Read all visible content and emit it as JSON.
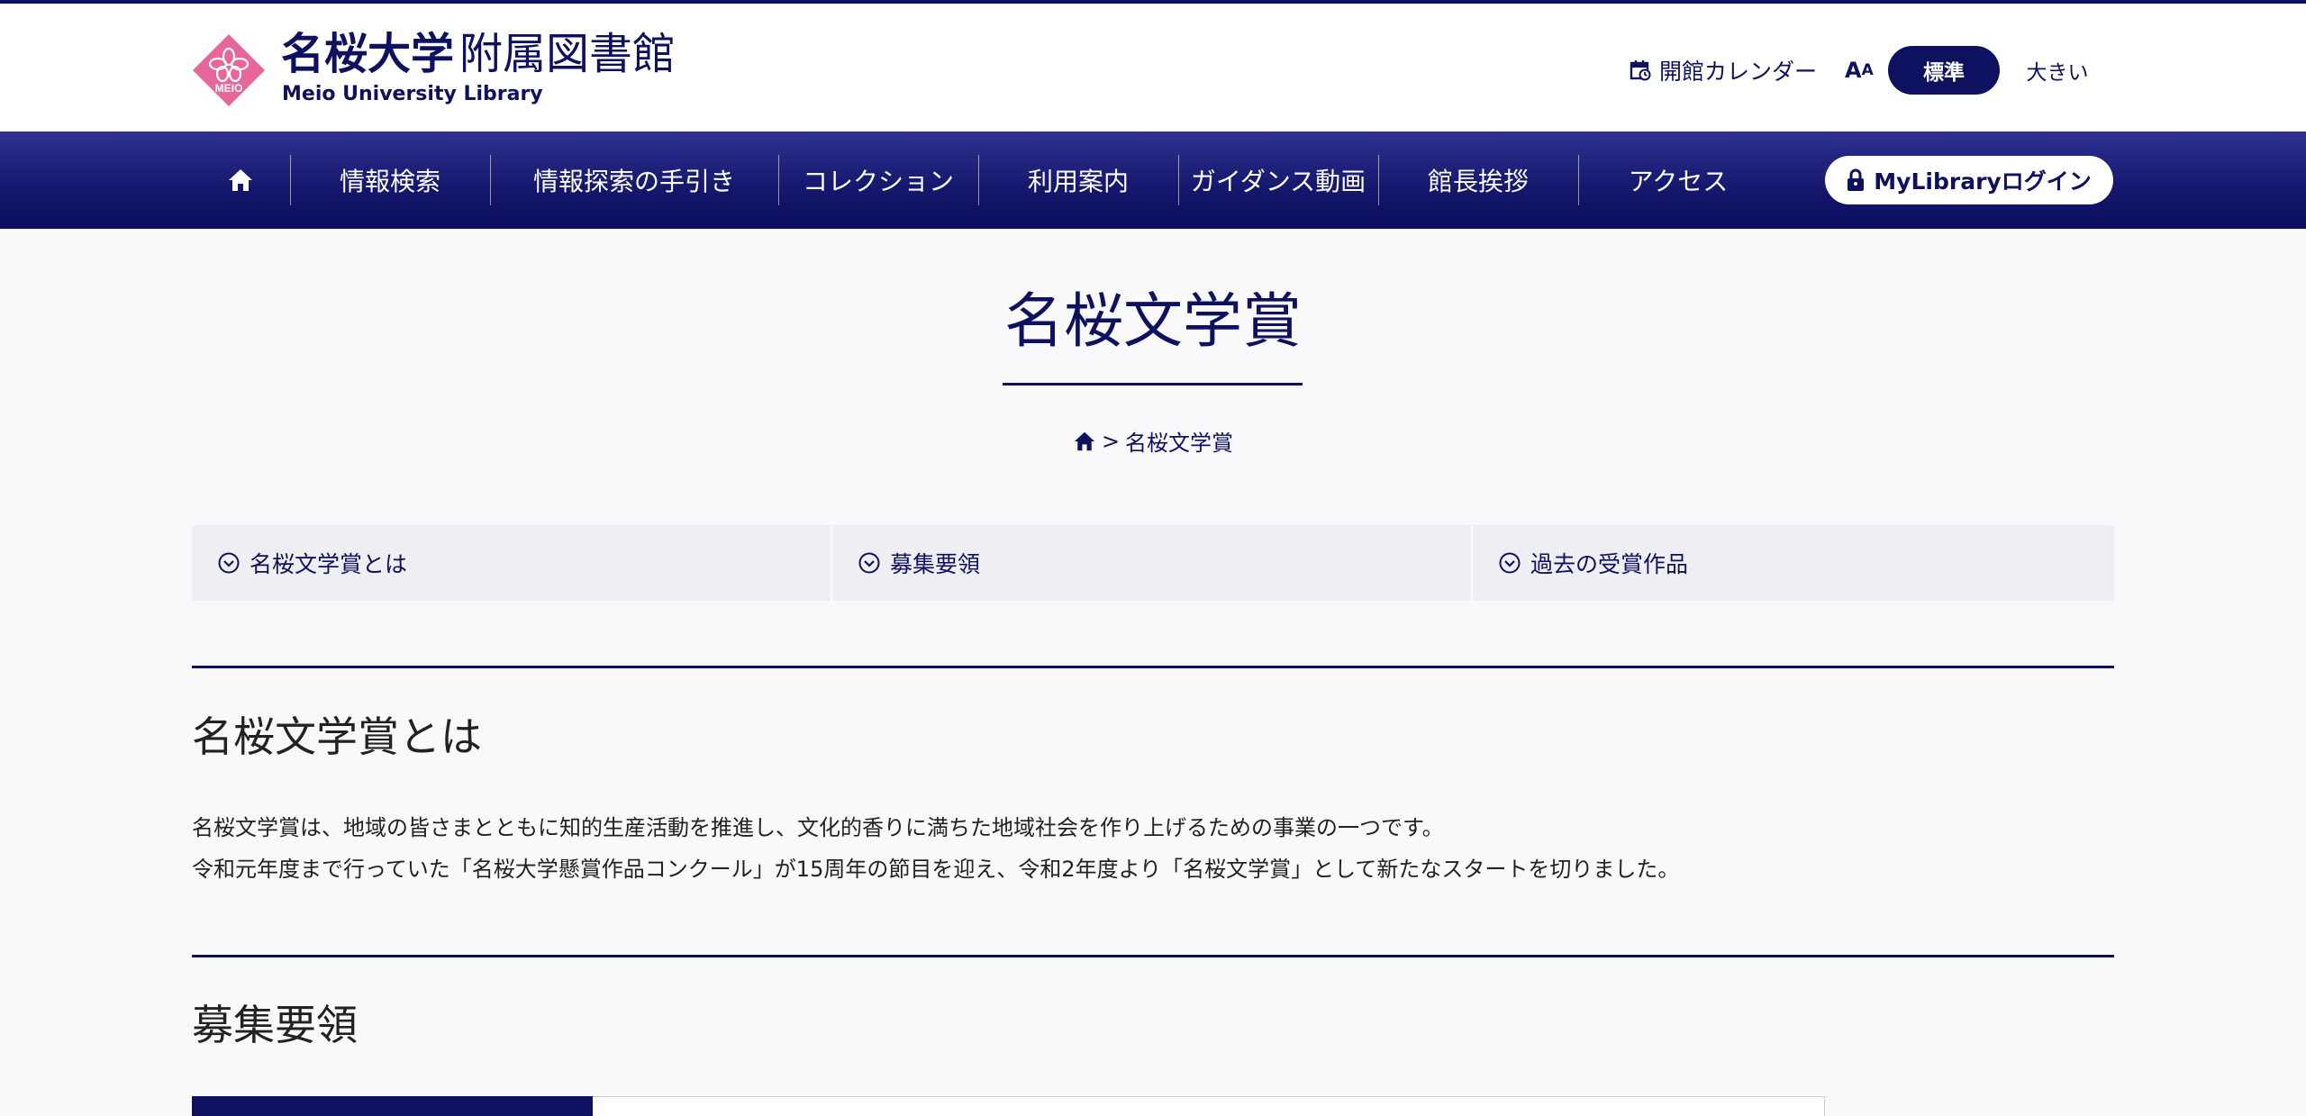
{
  "header": {
    "title_university": "名桜大学",
    "title_library": "附属図書館",
    "subtitle": "Meio University Library",
    "logo_text": "MEIO",
    "calendar_label": "開館カレンダー",
    "fontsize_icon_label": "A",
    "fontsize_standard": "標準",
    "fontsize_large": "大きい"
  },
  "nav": {
    "items": [
      {
        "label": "情報検索"
      },
      {
        "label": "情報探索の手引き"
      },
      {
        "label": "コレクション"
      },
      {
        "label": "利用案内"
      },
      {
        "label": "ガイダンス動画"
      },
      {
        "label": "館長挨拶"
      },
      {
        "label": "アクセス"
      }
    ],
    "login_label": "MyLibraryログイン"
  },
  "page": {
    "title": "名桜文学賞",
    "breadcrumb_separator": ">",
    "breadcrumb_current": "名桜文学賞"
  },
  "anchors": [
    {
      "label": "名桜文学賞とは"
    },
    {
      "label": "募集要領"
    },
    {
      "label": "過去の受賞作品"
    }
  ],
  "sections": {
    "about": {
      "heading": "名桜文学賞とは",
      "line1": "名桜文学賞は、地域の皆さまとともに知的生産活動を推進し、文化的香りに満ちた地域社会を作り上げるための事業の一つです。",
      "line2": "令和元年度まで行っていた「名桜大学懸賞作品コンクール」が15周年の節目を迎え、令和2年度より「名桜文学賞」として新たなスタートを切りました。"
    },
    "guidelines": {
      "heading": "募集要領"
    }
  },
  "colors": {
    "brand_navy": "#0e1060",
    "logo_pink": "#e8679a",
    "anchor_bg": "#eeeef3"
  }
}
